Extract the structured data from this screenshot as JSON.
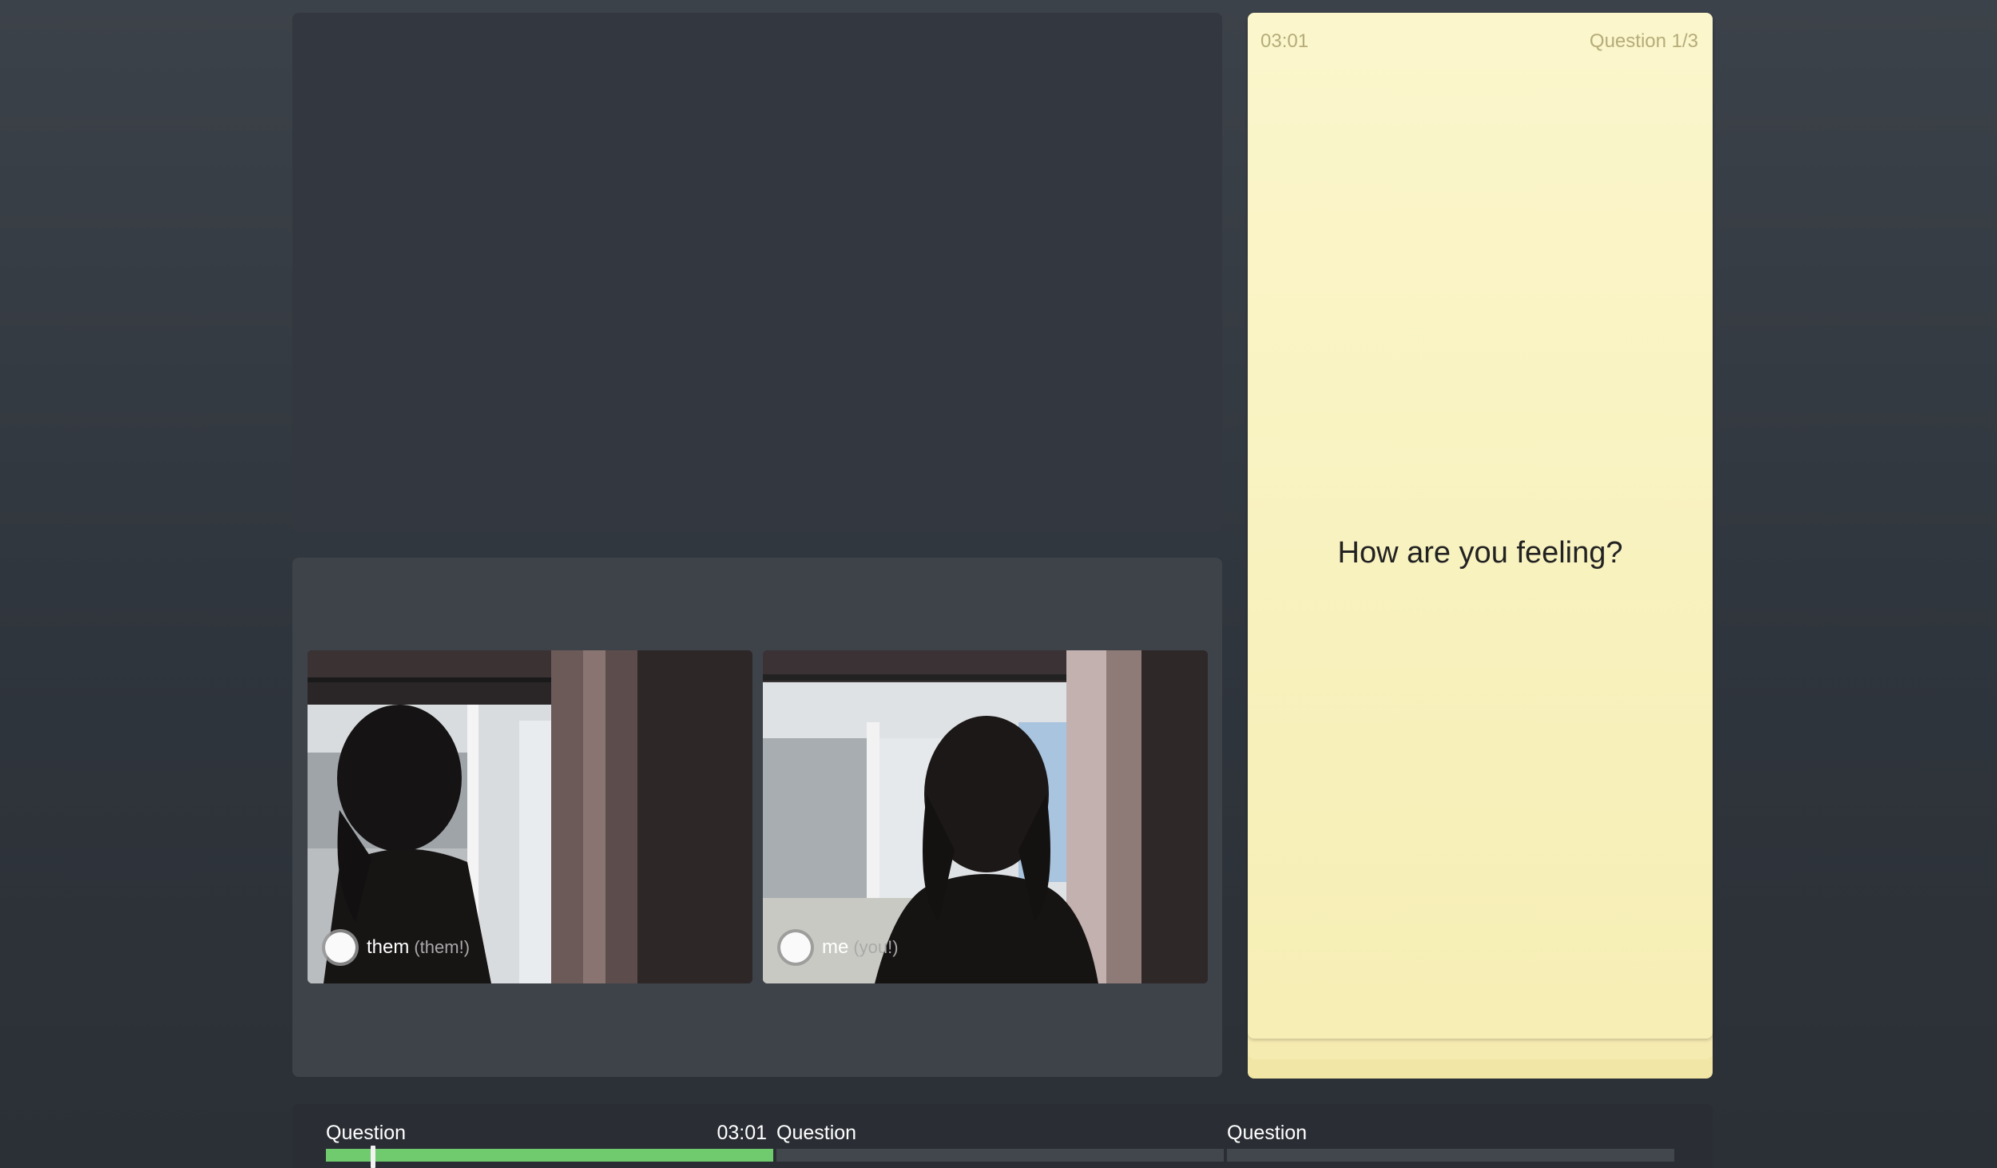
{
  "card": {
    "timer": "03:01",
    "counter": "Question 1/3",
    "question": "How are you feeling?"
  },
  "participants": [
    {
      "name": "them",
      "tag": "(them!)"
    },
    {
      "name": "me",
      "tag": "(you!)"
    }
  ],
  "timeline": {
    "segments": [
      {
        "label": "Question",
        "time": "03:01",
        "progress": 1.0
      },
      {
        "label": "Question",
        "time": "",
        "progress": 0.0
      },
      {
        "label": "Question",
        "time": "",
        "progress": 0.0
      }
    ],
    "marker_progress": 0.1
  },
  "colors": {
    "progress_fill": "#6fcb6d",
    "card_background": "#f8f1bd",
    "page_background": "#353a41"
  }
}
